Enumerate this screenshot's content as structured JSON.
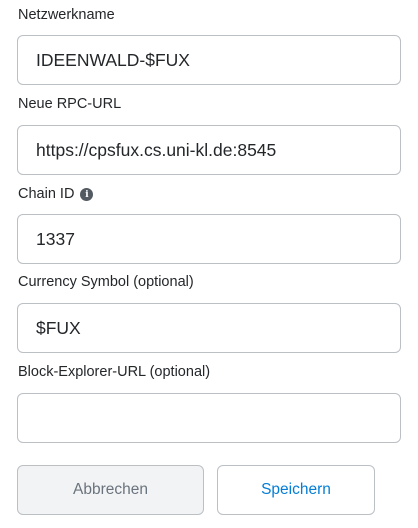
{
  "form": {
    "network_name": {
      "label": "Netzwerkname",
      "value": "IDEENWALD-$FUX"
    },
    "rpc_url": {
      "label": "Neue RPC-URL",
      "value": "https://cpsfux.cs.uni-kl.de:8545"
    },
    "chain_id": {
      "label": "Chain ID",
      "value": "1337",
      "info_icon": "i"
    },
    "currency_symbol": {
      "label": "Currency Symbol (optional)",
      "value": "$FUX"
    },
    "block_explorer_url": {
      "label": "Block-Explorer-URL (optional)",
      "value": ""
    }
  },
  "buttons": {
    "cancel_label": "Abbrechen",
    "save_label": "Speichern"
  },
  "colors": {
    "text": "#24272a",
    "border": "#bbc0c5",
    "cancel_bg": "#f2f3f4",
    "cancel_text": "#6a737d",
    "accent": "#037dd6",
    "info_icon": "#535a61"
  }
}
